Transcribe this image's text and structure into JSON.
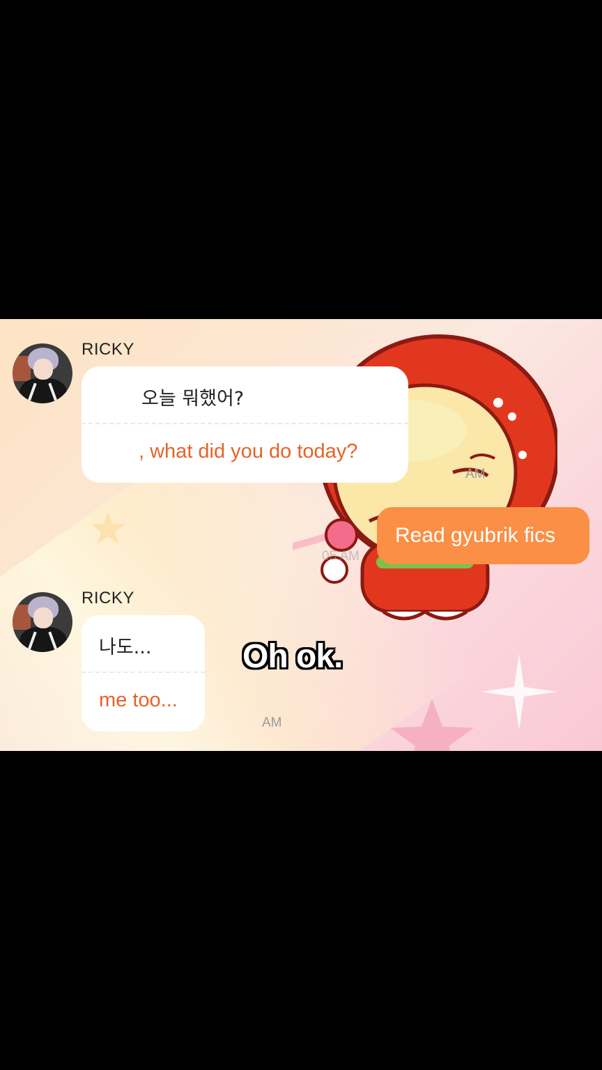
{
  "chat": {
    "messages": [
      {
        "sender": "RICKY",
        "original": "오늘 뭐했어?",
        "translation": ", what did you do today?",
        "time": "AM"
      },
      {
        "outgoing": true,
        "text": "Read gyubrik fics",
        "time": "05 AM"
      },
      {
        "sender": "RICKY",
        "original": "나도...",
        "translation": "me too...",
        "time": "AM"
      }
    ]
  },
  "caption": "Oh ok.",
  "colors": {
    "outgoing_bubble": "#fa8f45",
    "translation_text": "#e4632a",
    "letterbox": "#000000"
  },
  "icons": [
    "avatar-photo",
    "strawberry-hood-sticker"
  ]
}
